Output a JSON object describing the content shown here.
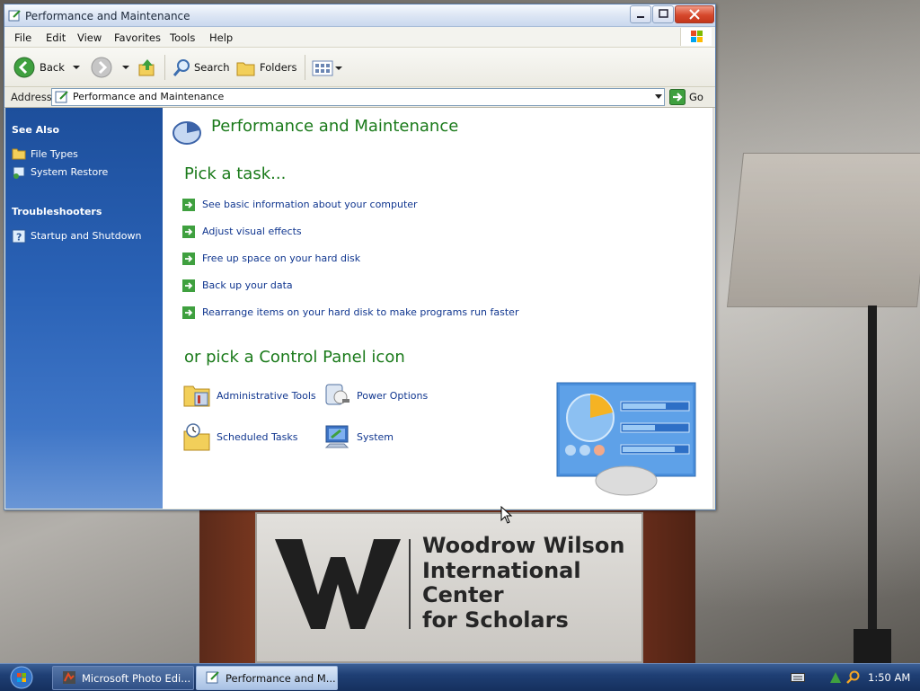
{
  "window": {
    "title": "Performance and Maintenance",
    "menu": [
      "File",
      "Edit",
      "View",
      "Favorites",
      "Tools",
      "Help"
    ],
    "toolbar": {
      "back_label": "Back",
      "search_label": "Search",
      "folders_label": "Folders"
    },
    "address": {
      "label": "Address",
      "value": "Performance and Maintenance",
      "go_label": "Go"
    }
  },
  "sidebar": {
    "see_also_heading": "See Also",
    "see_also_items": [
      "File Types",
      "System Restore"
    ],
    "troubleshooters_heading": "Troubleshooters",
    "troubleshooter_items": [
      "Startup and Shutdown"
    ]
  },
  "main": {
    "title": "Performance and Maintenance",
    "pick_task_heading": "Pick a task...",
    "tasks": [
      "See basic information about your computer",
      "Adjust visual effects",
      "Free up space on your hard disk",
      "Back up your data",
      "Rearrange items on your hard disk to make programs run faster"
    ],
    "pick_icon_heading": "or pick a Control Panel icon",
    "icons": [
      "Administrative Tools",
      "Power Options",
      "Scheduled Tasks",
      "System"
    ]
  },
  "desktop": {
    "podium_sign": [
      "Woodrow Wilson",
      "International",
      "Center",
      "for Scholars"
    ]
  },
  "taskbar": {
    "buttons": [
      "Microsoft Photo Edi...",
      "Performance and M..."
    ],
    "active_button": "Performance and M...",
    "clock": "1:50 AM"
  },
  "colors": {
    "heading_green": "#1a7a1a",
    "link_blue": "#10368f",
    "sidebar_blue": "#2a62b6"
  }
}
